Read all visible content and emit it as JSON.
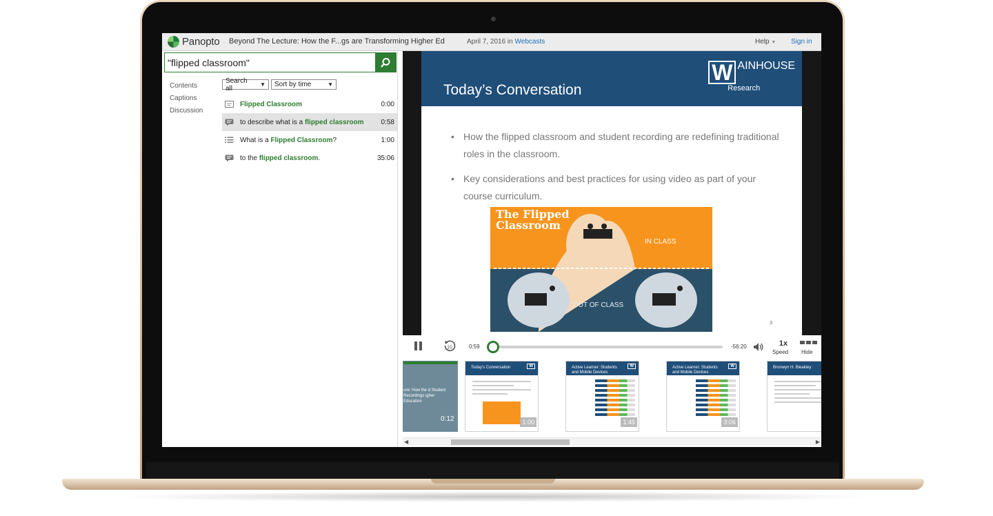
{
  "app": {
    "brand": "Panopto",
    "session_title": "Beyond The Lecture: How the F...gs are Transforming Higher Ed",
    "date_prefix": "April 7, 2016 in",
    "folder_link": "Webcasts",
    "help_label": "Help",
    "signin_label": "Sign in"
  },
  "search": {
    "value": "\"flipped classroom\"",
    "side_tabs": [
      "Contents",
      "Captions",
      "Discussion"
    ],
    "filter_scope": "Search all",
    "filter_sort": "Sort by time"
  },
  "results": [
    {
      "icon": "slide-icon",
      "pre": "",
      "match": "Flipped Classroom",
      "post": "",
      "time": "0:00"
    },
    {
      "icon": "caption-icon",
      "pre": "to describe what is a ",
      "match": "flipped classroom",
      "post": ".",
      "time": "0:58"
    },
    {
      "icon": "list-icon",
      "pre": "What is a ",
      "match": "Flipped Classroom",
      "post": "?",
      "time": "1:00"
    },
    {
      "icon": "caption-icon",
      "pre": "to the ",
      "match": "flipped classroom",
      "post": ".",
      "time": "35:06"
    }
  ],
  "slide": {
    "title": "Today’s Conversation",
    "brand_name": "AINHOUSE",
    "brand_sub": "Research",
    "bullets": [
      "How the flipped classroom and student recording are redefining traditional roles in the classroom.",
      "Key considerations and best practices for using video as part of your course curriculum."
    ],
    "graphic_title": "The Flipped Classroom",
    "graphic_in": "IN CLASS",
    "graphic_out": "OUT OF CLASS",
    "page_number": "3"
  },
  "player": {
    "current_time": "0:59",
    "remaining_time": "-56:20",
    "progress": 0.01,
    "speed_value": "1x",
    "speed_label": "Speed",
    "hide_label": "Hide"
  },
  "thumbnails": [
    {
      "title": "ure: How the d Student Recordings igher Education",
      "time": "0:12"
    },
    {
      "title": "Today’s Conversation",
      "time": "1:00"
    },
    {
      "title": "Active Learner: Students and Mobile Devices",
      "time": "1:45"
    },
    {
      "title": "Active Learner: Students and Mobile Devices",
      "time": "3:06"
    },
    {
      "title": "Bronwyn H. Bleakley",
      "time": ""
    }
  ],
  "colors": {
    "accent": "#2e7d32",
    "slide_header": "#1f4e79",
    "graphic_orange": "#f7941d"
  }
}
